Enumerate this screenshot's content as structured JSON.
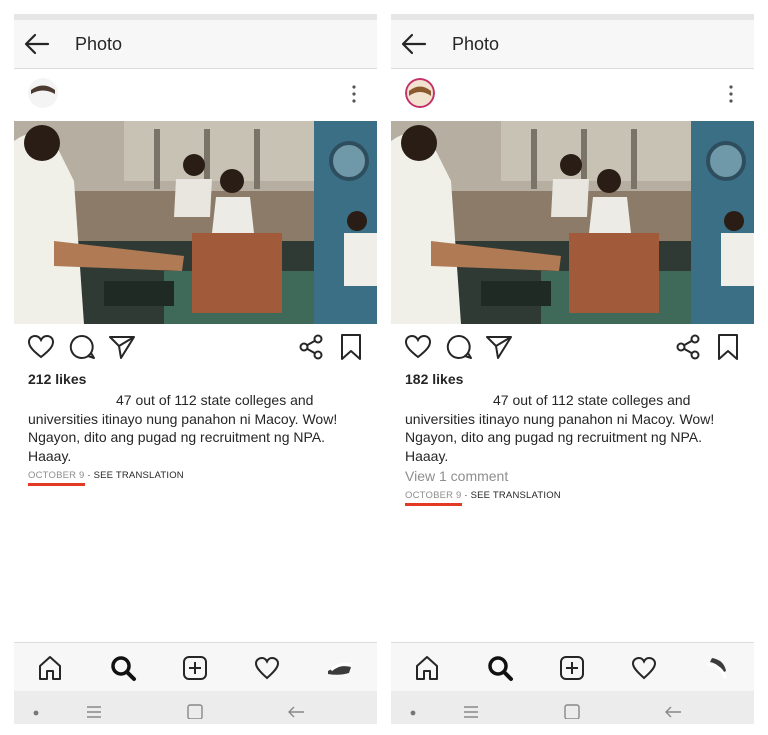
{
  "panels": {
    "left": {
      "header": {
        "title": "Photo"
      },
      "post": {
        "likes": "212 likes",
        "caption": {
          "line1": "47 out of 112 state colleges and",
          "line2": "universities itinayo nung panahon ni Macoy. Wow!",
          "line3": "Ngayon, dito ang pugad ng recruitment ng NPA.",
          "line4": "Haaay."
        },
        "date": "OCTOBER 9",
        "see_translation": "SEE TRANSLATION"
      }
    },
    "right": {
      "header": {
        "title": "Photo"
      },
      "post": {
        "likes": "182 likes",
        "caption": {
          "line1": "47 out of 112 state colleges and",
          "line2": "universities itinayo nung panahon ni Macoy. Wow!",
          "line3": "Ngayon, dito ang pugad ng recruitment ng NPA.",
          "line4": "Haaay."
        },
        "view_comments": "View 1 comment",
        "date": "OCTOBER 9",
        "see_translation": "SEE TRANSLATION"
      }
    }
  },
  "separator": " · ",
  "icons": {
    "header": [
      "back-arrow-icon"
    ],
    "post": [
      "more-options-icon"
    ],
    "actions": [
      "heart-icon",
      "comment-icon",
      "send-icon",
      "share-icon",
      "bookmark-icon"
    ],
    "nav": [
      "home-icon",
      "search-icon",
      "add-post-icon",
      "activity-heart-icon",
      "profile-icon"
    ],
    "system": [
      "recent-apps-dot-icon",
      "recents-icon",
      "home-square-icon",
      "system-back-icon"
    ]
  },
  "colors": {
    "text": "#262626",
    "muted": "#8e8e8e",
    "underline": "#e23a23",
    "bar": "#f7f7f7",
    "system_bar": "#ececec"
  }
}
